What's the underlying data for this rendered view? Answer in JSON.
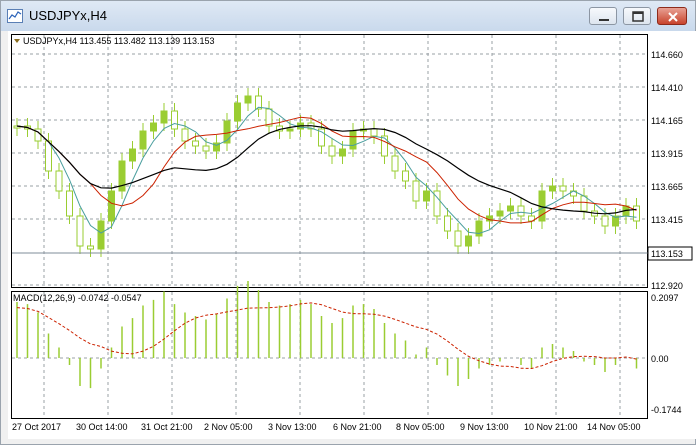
{
  "window": {
    "title": "USDJPYx,H4",
    "buttons": [
      "minimize",
      "maximize",
      "close"
    ]
  },
  "main_chart": {
    "header": "USDJPYx,H4  113.455 113.482 113.139 113.153",
    "price_labels": [
      "114.660",
      "114.410",
      "114.165",
      "113.915",
      "113.665",
      "113.415",
      "112.920"
    ],
    "current_price": "113.153",
    "current_price_color": "#000000",
    "candle_color": "#9acd32",
    "ma_colors": {
      "fast": "#4a9e9e",
      "medium": "#cc2200",
      "slow": "#000000"
    }
  },
  "macd": {
    "header": "MACD(12,26,9) -0.0742 -0.0547",
    "labels": [
      "0.2097",
      "0.00",
      "-0.1744"
    ],
    "histogram_color": "#9acd32",
    "signal_color": "#cc2200"
  },
  "time_axis": [
    "27 Oct 2017",
    "30 Oct 14:00",
    "31 Oct 21:00",
    "2 Nov 05:00",
    "3 Nov 13:00",
    "6 Nov 21:00",
    "8 Nov 05:00",
    "9 Nov 13:00",
    "10 Nov 21:00",
    "14 Nov 05:00"
  ]
}
